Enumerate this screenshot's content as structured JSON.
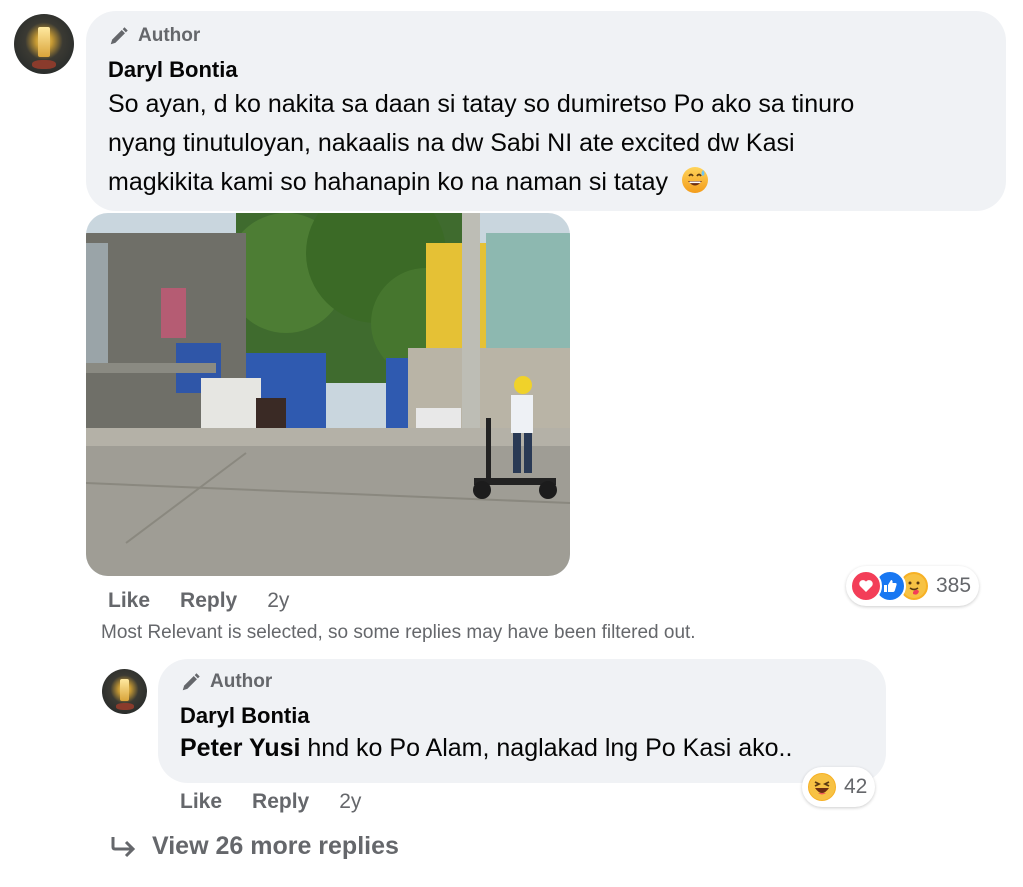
{
  "comment": {
    "badge": "Author",
    "name": "Daryl Bontia",
    "lines": [
      "So ayan, d ko nakita sa daan si tatay so dumiretso Po ako sa tinuro",
      "nyang tinutuloyan, nakaalis na dw Sabi NI ate excited dw Kasi",
      "magkikita kami so hahanapin ko na naman si tatay"
    ],
    "emoji": "grinning-sweat-emoji",
    "actions": {
      "like": "Like",
      "reply": "Reply",
      "time": "2y"
    },
    "reaction_count": "385",
    "reactions": [
      "love-icon",
      "like-icon",
      "care-icon"
    ]
  },
  "filter_note": "Most Relevant is selected, so some replies may have been filtered out.",
  "reply": {
    "badge": "Author",
    "name": "Daryl Bontia",
    "mention": "Peter Yusi",
    "text": " hnd ko Po Alam, naglakad lng Po Kasi ako..",
    "actions": {
      "like": "Like",
      "reply": "Reply",
      "time": "2y"
    },
    "reaction_count": "42",
    "reactions": [
      "haha-icon"
    ]
  },
  "view_more": "View 26 more replies",
  "colors": {
    "bubble": "#f0f2f5",
    "secondary_text": "#65676b",
    "like_blue": "#1877f2",
    "love_red": "#f33e58",
    "haha_yellow": "#f7b125"
  }
}
